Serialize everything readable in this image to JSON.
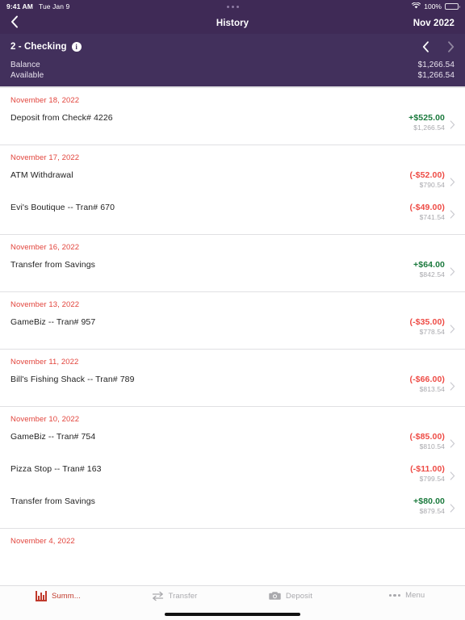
{
  "statusbar": {
    "time": "9:41 AM",
    "date": "Tue Jan 9",
    "battery_percent": "100%",
    "wifi_icon": "wifi-icon",
    "battery_icon": "battery-icon",
    "center_dots_icon": "more-dots-icon"
  },
  "navbar": {
    "back_icon": "chevron-left-icon",
    "title": "History",
    "month": "Nov 2022"
  },
  "account": {
    "name": "2 - Checking",
    "info_icon": "info-icon",
    "prev_icon": "chevron-left-icon",
    "next_icon": "chevron-right-icon",
    "balance_label": "Balance",
    "balance_value": "$1,266.54",
    "available_label": "Available",
    "available_value": "$1,266.54"
  },
  "colors": {
    "header_purple": "#3F2A56",
    "account_purple": "#42305C",
    "date_red": "#e2443c",
    "credit_green": "#1b7a3d",
    "debit_red": "#ee4b45",
    "running_balance_grey": "#a8a8ad",
    "tab_active": "#c0392b",
    "tab_inactive": "#a9a9ad"
  },
  "groups": [
    {
      "date": "November 18, 2022",
      "transactions": [
        {
          "description": "Deposit from Check# 4226",
          "amount": "+$525.00",
          "sign": "pos",
          "running_balance": "$1,266.54",
          "chevron_icon": "chevron-right-icon"
        }
      ]
    },
    {
      "date": "November 17, 2022",
      "transactions": [
        {
          "description": "ATM Withdrawal",
          "amount": "(-$52.00)",
          "sign": "neg",
          "running_balance": "$790.54",
          "chevron_icon": "chevron-right-icon"
        },
        {
          "description": "Evi's Boutique -- Tran# 670",
          "amount": "(-$49.00)",
          "sign": "neg",
          "running_balance": "$741.54",
          "chevron_icon": "chevron-right-icon"
        }
      ]
    },
    {
      "date": "November 16, 2022",
      "transactions": [
        {
          "description": "Transfer from Savings",
          "amount": "+$64.00",
          "sign": "pos",
          "running_balance": "$842.54",
          "chevron_icon": "chevron-right-icon"
        }
      ]
    },
    {
      "date": "November 13, 2022",
      "transactions": [
        {
          "description": "GameBiz -- Tran# 957",
          "amount": "(-$35.00)",
          "sign": "neg",
          "running_balance": "$778.54",
          "chevron_icon": "chevron-right-icon"
        }
      ]
    },
    {
      "date": "November 11, 2022",
      "transactions": [
        {
          "description": "Bill's Fishing Shack -- Tran# 789",
          "amount": "(-$66.00)",
          "sign": "neg",
          "running_balance": "$813.54",
          "chevron_icon": "chevron-right-icon"
        }
      ]
    },
    {
      "date": "November 10, 2022",
      "transactions": [
        {
          "description": "GameBiz -- Tran# 754",
          "amount": "(-$85.00)",
          "sign": "neg",
          "running_balance": "$810.54",
          "chevron_icon": "chevron-right-icon"
        },
        {
          "description": "Pizza Stop -- Tran# 163",
          "amount": "(-$11.00)",
          "sign": "neg",
          "running_balance": "$799.54",
          "chevron_icon": "chevron-right-icon"
        },
        {
          "description": "Transfer from Savings",
          "amount": "+$80.00",
          "sign": "pos",
          "running_balance": "$879.54",
          "chevron_icon": "chevron-right-icon"
        }
      ]
    },
    {
      "date": "November 4, 2022",
      "transactions": []
    }
  ],
  "tabbar": {
    "items": [
      {
        "label": "Summ...",
        "icon": "bar-chart-icon",
        "active": true
      },
      {
        "label": "Transfer",
        "icon": "transfer-arrows-icon",
        "active": false
      },
      {
        "label": "Deposit",
        "icon": "camera-icon",
        "active": false
      },
      {
        "label": "Menu",
        "icon": "more-dots-icon",
        "active": false
      }
    ]
  }
}
